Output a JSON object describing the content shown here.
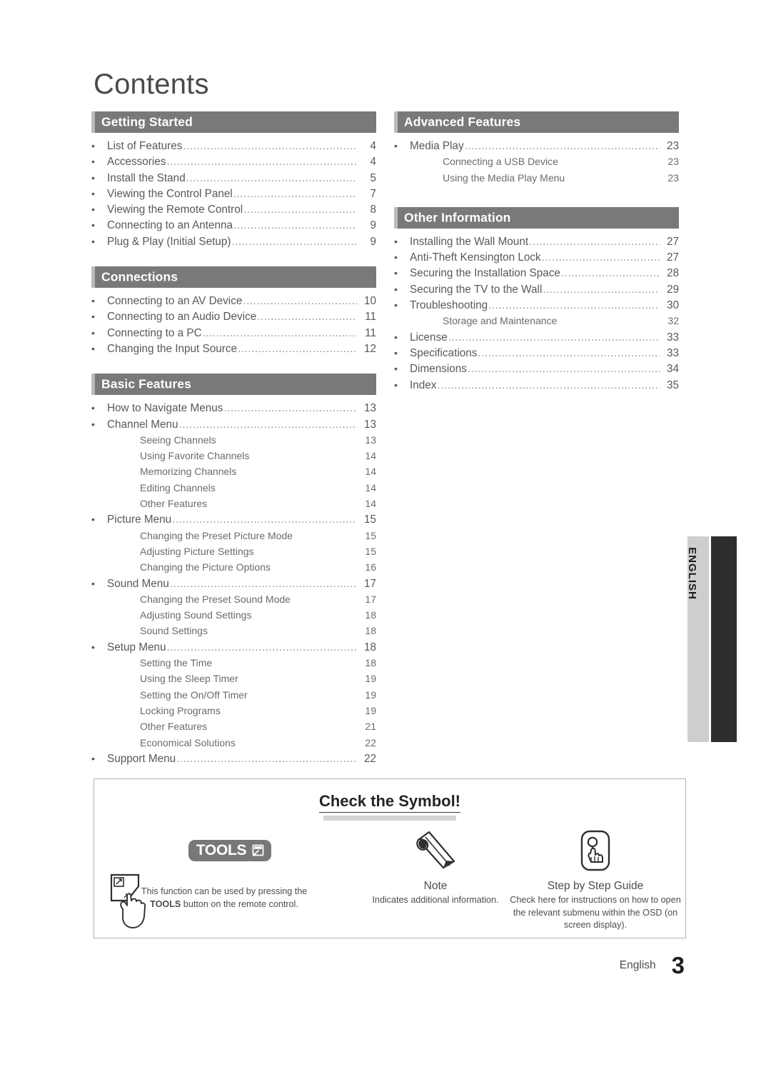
{
  "page": {
    "title": "Contents",
    "footer_language": "English",
    "footer_page_number": "3",
    "side_tab_language": "ENGLISH"
  },
  "columns": {
    "left": [
      {
        "header": "Getting Started",
        "entries": [
          {
            "level": 1,
            "label": "List of Features",
            "page": "4"
          },
          {
            "level": 1,
            "label": "Accessories",
            "page": "4"
          },
          {
            "level": 1,
            "label": "Install the Stand",
            "page": "5"
          },
          {
            "level": 1,
            "label": "Viewing the Control Panel",
            "page": "7"
          },
          {
            "level": 1,
            "label": "Viewing the Remote Control",
            "page": "8"
          },
          {
            "level": 1,
            "label": "Connecting to an Antenna",
            "page": "9"
          },
          {
            "level": 1,
            "label": "Plug & Play (Initial Setup)",
            "page": "9"
          }
        ]
      },
      {
        "header": "Connections",
        "entries": [
          {
            "level": 1,
            "label": "Connecting to an AV Device",
            "page": "10"
          },
          {
            "level": 1,
            "label": "Connecting to an Audio Device",
            "page": "11"
          },
          {
            "level": 1,
            "label": "Connecting to a PC",
            "page": "11"
          },
          {
            "level": 1,
            "label": "Changing the Input Source",
            "page": "12"
          }
        ]
      },
      {
        "header": "Basic Features",
        "entries": [
          {
            "level": 1,
            "label": "How to Navigate Menus",
            "page": "13"
          },
          {
            "level": 1,
            "label": "Channel Menu",
            "page": "13"
          },
          {
            "level": 2,
            "label": "Seeing Channels",
            "page": "13"
          },
          {
            "level": 2,
            "label": "Using Favorite Channels",
            "page": "14"
          },
          {
            "level": 2,
            "label": "Memorizing Channels",
            "page": "14"
          },
          {
            "level": 2,
            "label": "Editing Channels",
            "page": "14"
          },
          {
            "level": 2,
            "label": "Other Features",
            "page": "14"
          },
          {
            "level": 1,
            "label": "Picture Menu",
            "page": "15"
          },
          {
            "level": 2,
            "label": "Changing the Preset Picture Mode",
            "page": "15"
          },
          {
            "level": 2,
            "label": "Adjusting Picture Settings",
            "page": "15"
          },
          {
            "level": 2,
            "label": "Changing the Picture Options",
            "page": "16"
          },
          {
            "level": 1,
            "label": "Sound Menu",
            "page": "17"
          },
          {
            "level": 2,
            "label": "Changing the Preset Sound Mode",
            "page": "17"
          },
          {
            "level": 2,
            "label": "Adjusting Sound Settings",
            "page": "18"
          },
          {
            "level": 2,
            "label": "Sound Settings",
            "page": "18"
          },
          {
            "level": 1,
            "label": "Setup Menu",
            "page": "18"
          },
          {
            "level": 2,
            "label": "Setting the Time",
            "page": "18"
          },
          {
            "level": 2,
            "label": "Using the Sleep Timer",
            "page": "19"
          },
          {
            "level": 2,
            "label": "Setting the On/Off Timer",
            "page": "19"
          },
          {
            "level": 2,
            "label": "Locking Programs",
            "page": "19"
          },
          {
            "level": 2,
            "label": "Other Features",
            "page": "21"
          },
          {
            "level": 2,
            "label": "Economical Solutions",
            "page": "22"
          },
          {
            "level": 1,
            "label": "Support Menu",
            "page": "22"
          }
        ]
      }
    ],
    "right": [
      {
        "header": "Advanced Features",
        "entries": [
          {
            "level": 1,
            "label": "Media Play",
            "page": "23"
          },
          {
            "level": 2,
            "label": "Connecting a USB Device",
            "page": "23"
          },
          {
            "level": 2,
            "label": "Using the Media Play Menu",
            "page": "23"
          }
        ]
      },
      {
        "header": "Other Information",
        "entries": [
          {
            "level": 1,
            "label": "Installing the Wall Mount",
            "page": "27"
          },
          {
            "level": 1,
            "label": "Anti-Theft Kensington Lock",
            "page": "27"
          },
          {
            "level": 1,
            "label": "Securing the Installation Space",
            "page": "28"
          },
          {
            "level": 1,
            "label": "Securing the TV to the Wall",
            "page": "29"
          },
          {
            "level": 1,
            "label": "Troubleshooting",
            "page": "30"
          },
          {
            "level": 2,
            "label": "Storage and Maintenance",
            "page": "32"
          },
          {
            "level": 1,
            "label": "License",
            "page": "33"
          },
          {
            "level": 1,
            "label": "Specifications",
            "page": "33"
          },
          {
            "level": 1,
            "label": "Dimensions",
            "page": "34"
          },
          {
            "level": 1,
            "label": "Index",
            "page": "35"
          }
        ]
      }
    ]
  },
  "symbol_box": {
    "title": "Check the Symbol!",
    "items": [
      {
        "icon": "tools-badge-icon",
        "badge_label": "TOOLS",
        "heading": "",
        "description_line1": "This function can be used by pressing the",
        "description_bold": "TOOLS",
        "description_line2": " button on the remote control."
      },
      {
        "icon": "pencil-icon",
        "heading": "Note",
        "description": "Indicates additional information."
      },
      {
        "icon": "step-guide-icon",
        "heading": "Step by Step Guide",
        "description": "Check here for instructions on how to open the relevant submenu within the OSD (on screen display)."
      }
    ]
  },
  "colors": {
    "section_header_bg": "#77797b",
    "section_header_accent": "#b9bbbd",
    "tools_badge_bg": "#76787a",
    "side_tab_light": "#cdced0",
    "side_tab_dark": "#2e2d2d"
  }
}
